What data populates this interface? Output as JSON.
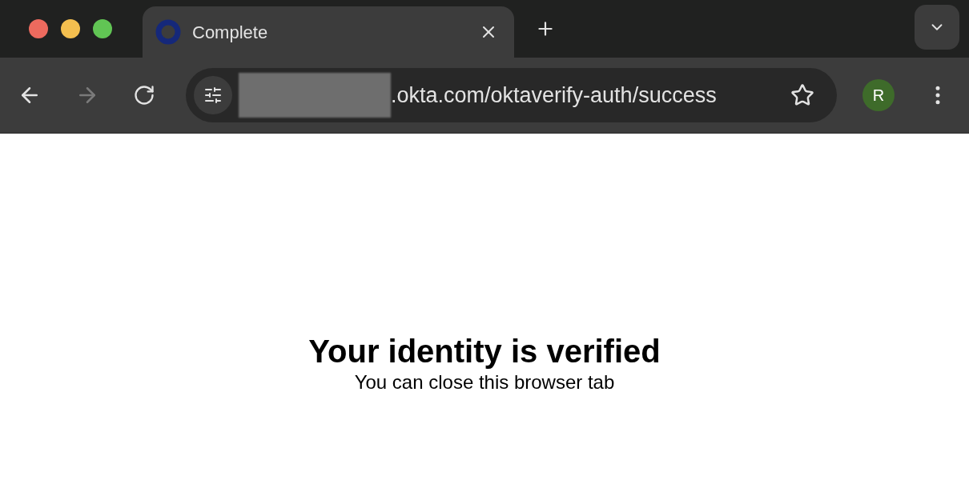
{
  "tabs": [
    {
      "title": "Complete",
      "selected": true
    }
  ],
  "toolbar": {
    "back": {
      "disabled": false
    },
    "forward": {
      "disabled": true
    }
  },
  "address_bar": {
    "url_visible": ".okta.com/oktaverify-auth/success",
    "bookmarked": false
  },
  "profile": {
    "initial": "R",
    "color": "#3e6b2a"
  },
  "page": {
    "heading": "Your identity is verified",
    "subtext": "You can close this browser tab"
  }
}
